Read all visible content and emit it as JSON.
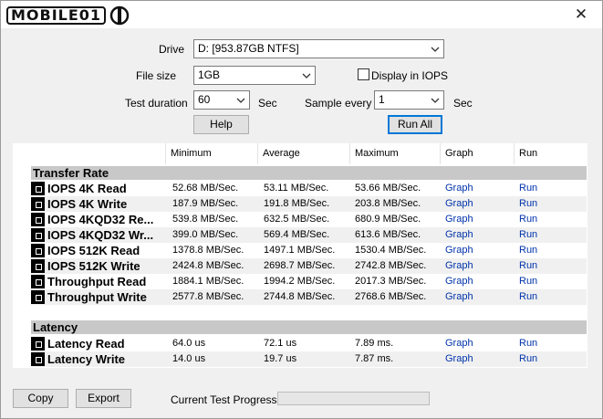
{
  "app": {
    "logo_text": "MOBILE01",
    "close_glyph": "✕"
  },
  "controls": {
    "drive_label": "Drive",
    "drive_value": "D: [953.87GB NTFS]",
    "filesize_label": "File size",
    "filesize_value": "1GB",
    "display_iops_label": "Display in IOPS",
    "display_iops_checked": false,
    "duration_label": "Test duration",
    "duration_value": "60",
    "duration_unit": "Sec",
    "sample_label": "Sample every",
    "sample_value": "1",
    "sample_unit": "Sec",
    "help_label": "Help",
    "runall_label": "Run All"
  },
  "table": {
    "headers": [
      "Minimum",
      "Average",
      "Maximum",
      "Graph",
      "Run"
    ],
    "transfer_section": "Transfer Rate",
    "transfer_rows": [
      {
        "name": "IOPS 4K Read",
        "min": "52.68 MB/Sec.",
        "avg": "53.11 MB/Sec.",
        "max": "53.66 MB/Sec.",
        "graph": "Graph",
        "run": "Run"
      },
      {
        "name": "IOPS 4K Write",
        "min": "187.9 MB/Sec.",
        "avg": "191.8 MB/Sec.",
        "max": "203.8 MB/Sec.",
        "graph": "Graph",
        "run": "Run"
      },
      {
        "name": "IOPS 4KQD32 Re...",
        "min": "539.8 MB/Sec.",
        "avg": "632.5 MB/Sec.",
        "max": "680.9 MB/Sec.",
        "graph": "Graph",
        "run": "Run"
      },
      {
        "name": "IOPS 4KQD32 Wr...",
        "min": "399.0 MB/Sec.",
        "avg": "569.4 MB/Sec.",
        "max": "613.6 MB/Sec.",
        "graph": "Graph",
        "run": "Run"
      },
      {
        "name": "IOPS 512K Read",
        "min": "1378.8 MB/Sec.",
        "avg": "1497.1 MB/Sec.",
        "max": "1530.4 MB/Sec.",
        "graph": "Graph",
        "run": "Run"
      },
      {
        "name": "IOPS 512K Write",
        "min": "2424.8 MB/Sec.",
        "avg": "2698.7 MB/Sec.",
        "max": "2742.8 MB/Sec.",
        "graph": "Graph",
        "run": "Run"
      },
      {
        "name": "Throughput Read",
        "min": "1884.1 MB/Sec.",
        "avg": "1994.2 MB/Sec.",
        "max": "2017.3 MB/Sec.",
        "graph": "Graph",
        "run": "Run"
      },
      {
        "name": "Throughput Write",
        "min": "2577.8 MB/Sec.",
        "avg": "2744.8 MB/Sec.",
        "max": "2768.6 MB/Sec.",
        "graph": "Graph",
        "run": "Run"
      }
    ],
    "latency_section": "Latency",
    "latency_rows": [
      {
        "name": "Latency Read",
        "min": "64.0 us",
        "avg": "72.1 us",
        "max": "7.89 ms.",
        "graph": "Graph",
        "run": "Run"
      },
      {
        "name": "Latency Write",
        "min": "14.0 us",
        "avg": "19.7 us",
        "max": "7.87 ms.",
        "graph": "Graph",
        "run": "Run"
      }
    ]
  },
  "footer": {
    "copy_label": "Copy",
    "export_label": "Export",
    "progress_label": "Current Test Progress",
    "progress_fraction": 0
  }
}
